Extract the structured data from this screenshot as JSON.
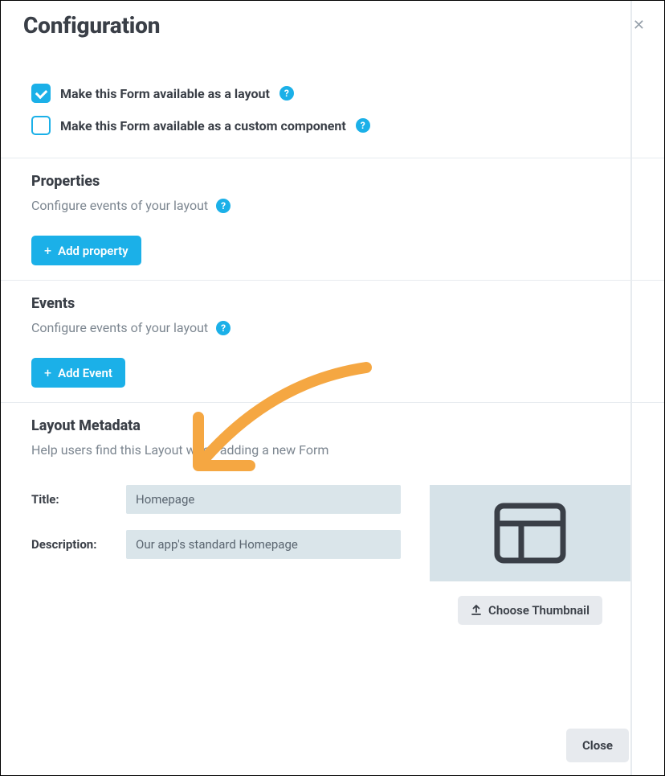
{
  "dialog": {
    "title": "Configuration"
  },
  "options": {
    "layout_label": "Make this Form available as a layout",
    "layout_checked": true,
    "component_label": "Make this Form available as a custom component",
    "component_checked": false,
    "help_glyph": "?"
  },
  "properties": {
    "title": "Properties",
    "description": "Configure events of your layout",
    "add_button": "Add property"
  },
  "events": {
    "title": "Events",
    "description": "Configure events of your layout",
    "add_button": "Add Event"
  },
  "metadata": {
    "title": "Layout Metadata",
    "description": "Help users find this Layout when adding a new Form",
    "fields": {
      "title_label": "Title:",
      "title_value": "Homepage",
      "description_label": "Description:",
      "description_value": "Our app's standard Homepage"
    },
    "choose_thumbnail": "Choose Thumbnail"
  },
  "footer": {
    "close": "Close"
  },
  "annotation": {
    "arrow_color": "#f5a742"
  }
}
